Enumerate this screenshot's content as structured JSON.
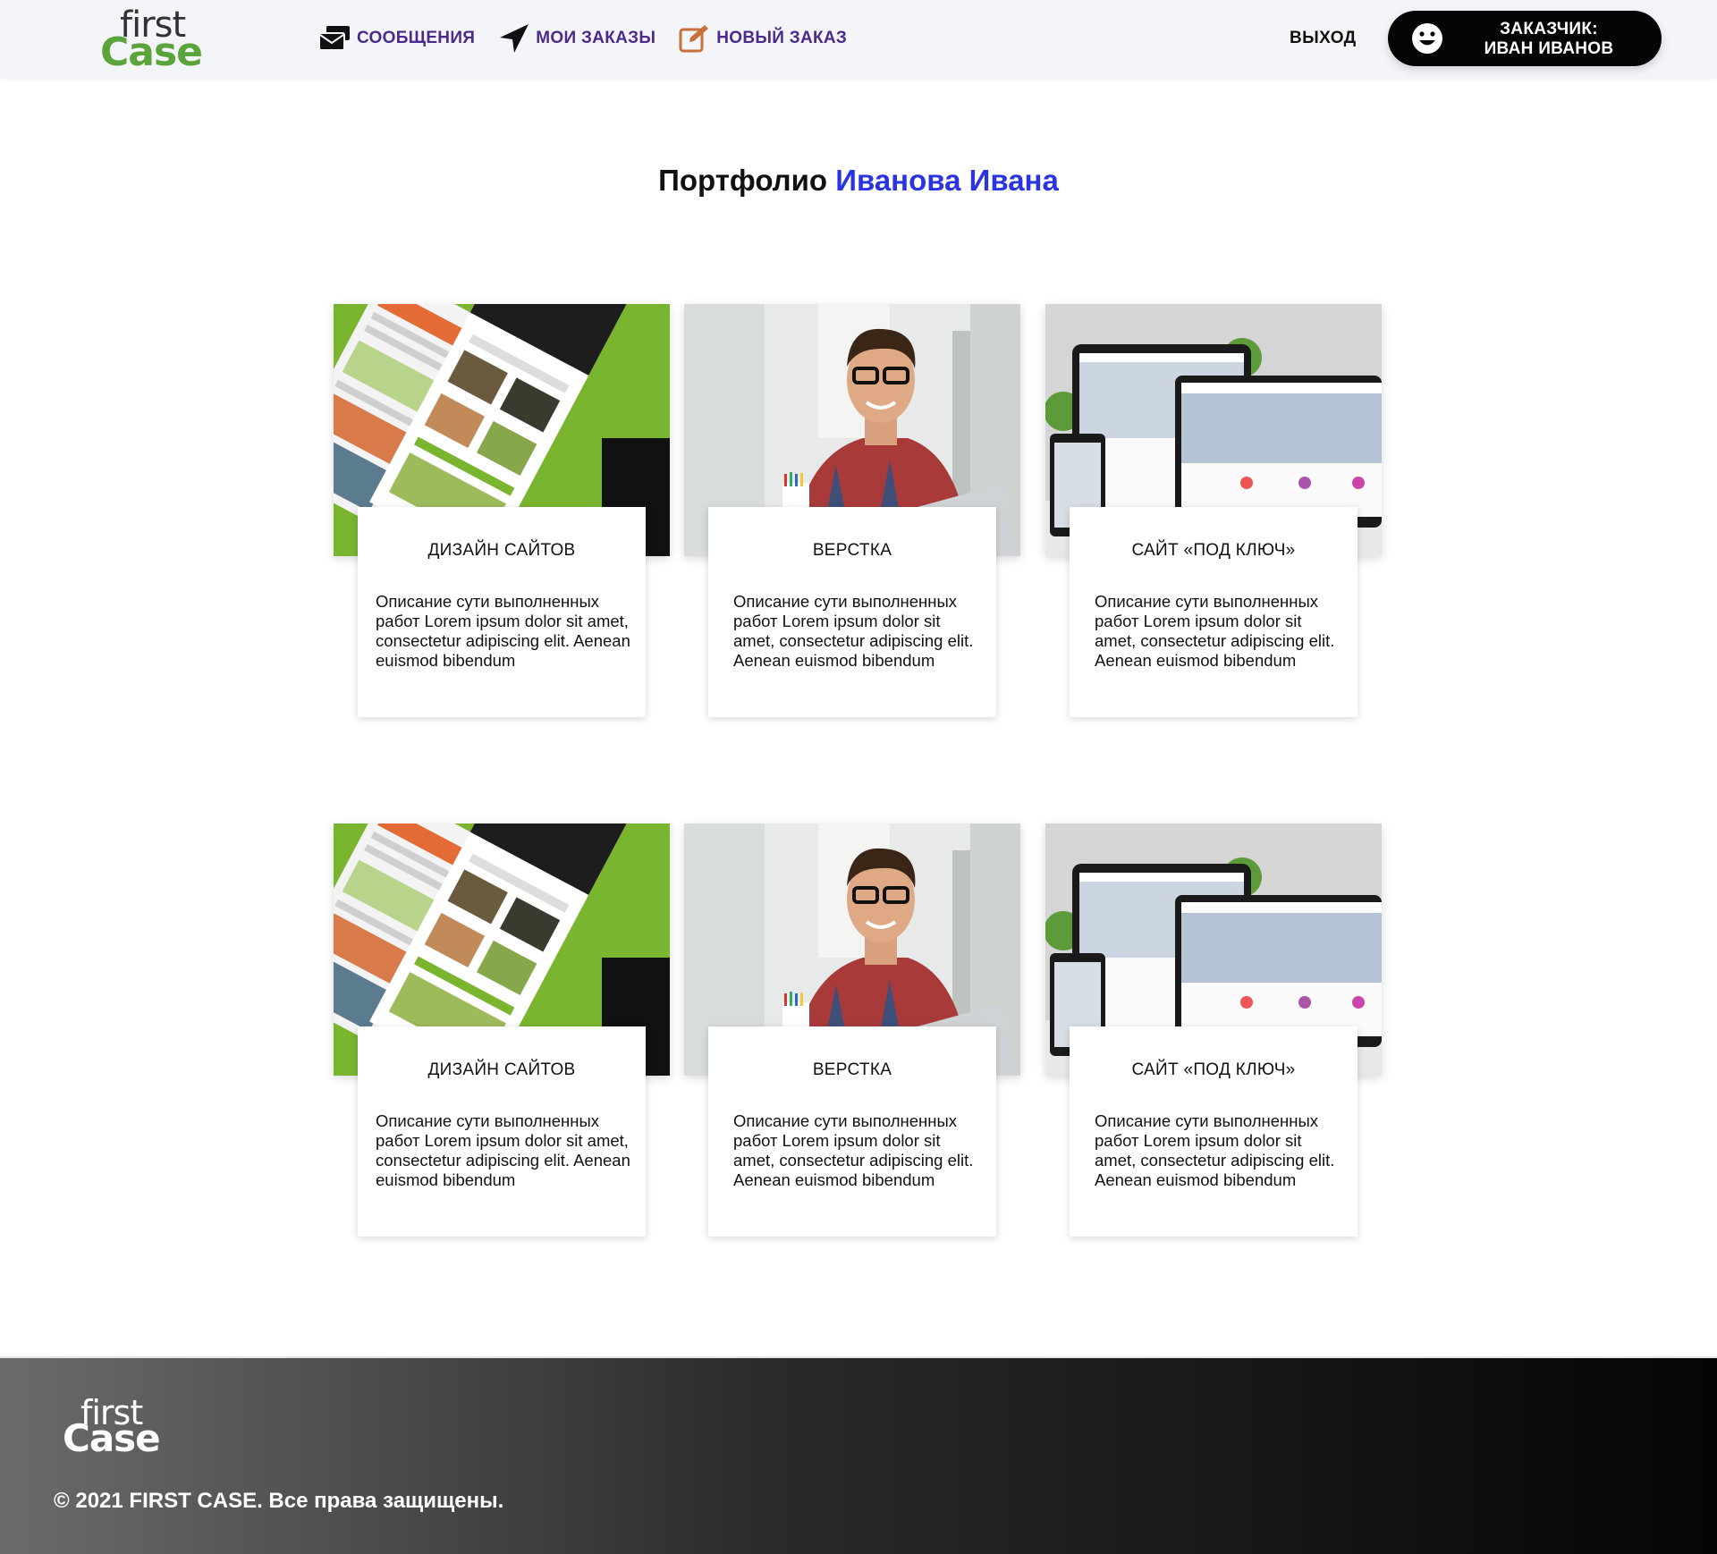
{
  "header": {
    "logo_top": "first",
    "logo_bottom": "Case",
    "nav": [
      {
        "label": "СООБЩЕНИЯ",
        "icon": "messages-icon"
      },
      {
        "label": "МОИ ЗАКАЗЫ",
        "icon": "paper-plane-icon"
      },
      {
        "label": "НОВЫЙ ЗАКАЗ",
        "icon": "edit-icon"
      }
    ],
    "logout_label": "ВЫХОД",
    "user_role": "ЗАКАЗЧИК:",
    "user_name": "ИВАН ИВАНОВ"
  },
  "main": {
    "title_prefix": "Портфолио",
    "title_name": "Иванова Ивана"
  },
  "cards": [
    {
      "title": "ДИЗАЙН САЙТОВ",
      "description": "Описание сути выполненных работ Lorem ipsum dolor sit amet, consectetur adipiscing elit. Aenean euismod bibendum",
      "image": "website-design-mockups"
    },
    {
      "title": "ВЕРСТКА",
      "description": "Описание сути выполненных работ Lorem ipsum dolor sit amet, consectetur adipiscing elit. Aenean euismod bibendum",
      "image": "smiling-man-at-laptop"
    },
    {
      "title": "САЙТ «ПОД КЛЮЧ»",
      "description": "Описание сути выполненных работ Lorem ipsum dolor sit amet, consectetur adipiscing elit. Aenean euismod bibendum",
      "image": "responsive-devices-mockup"
    },
    {
      "title": "ДИЗАЙН САЙТОВ",
      "description": "Описание сути выполненных работ Lorem ipsum dolor sit amet, consectetur adipiscing elit. Aenean euismod bibendum",
      "image": "website-design-mockups"
    },
    {
      "title": "ВЕРСТКА",
      "description": "Описание сути выполненных работ Lorem ipsum dolor sit amet, consectetur adipiscing elit. Aenean euismod bibendum",
      "image": "smiling-man-at-laptop"
    },
    {
      "title": "САЙТ «ПОД КЛЮЧ»",
      "description": "Описание сути выполненных работ Lorem ipsum dolor sit amet, consectetur adipiscing elit. Aenean euismod bibendum",
      "image": "responsive-devices-mockup"
    }
  ],
  "footer": {
    "logo_top": "first",
    "logo_bottom": "Case",
    "copyright": "© 2021 FIRST CASE. Все права защищены."
  },
  "colors": {
    "nav_text": "#4b2a8c",
    "accent_name": "#2a35e0",
    "logo_green": "#5ba43c",
    "edit_icon": "#c8703a"
  }
}
